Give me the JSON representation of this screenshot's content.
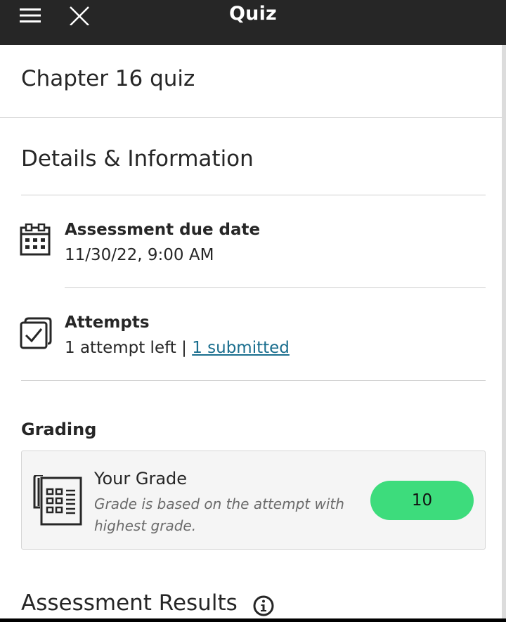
{
  "header": {
    "title": "Quiz",
    "menu_icon": "hamburger-menu-icon",
    "close_icon": "close-icon"
  },
  "page": {
    "title": "Chapter 16 quiz"
  },
  "details": {
    "heading": "Details & Information",
    "due_date": {
      "icon": "calendar-icon",
      "label": "Assessment due date",
      "value": "11/30/22, 9:00 AM"
    },
    "attempts": {
      "icon": "checkbox-stack-icon",
      "label": "Attempts",
      "left_text": "1 attempt left",
      "separator": "|",
      "submitted_link": "1 submitted",
      "link_color": "#1a6e8e"
    }
  },
  "grading": {
    "heading": "Grading",
    "card": {
      "icon": "gradebook-icon",
      "label": "Your Grade",
      "description": "Grade is based on the attempt with highest grade.",
      "grade_value": "10",
      "grade_color": "#3ddc7c"
    }
  },
  "results": {
    "heading": "Assessment Results",
    "info_icon": "info-icon"
  }
}
